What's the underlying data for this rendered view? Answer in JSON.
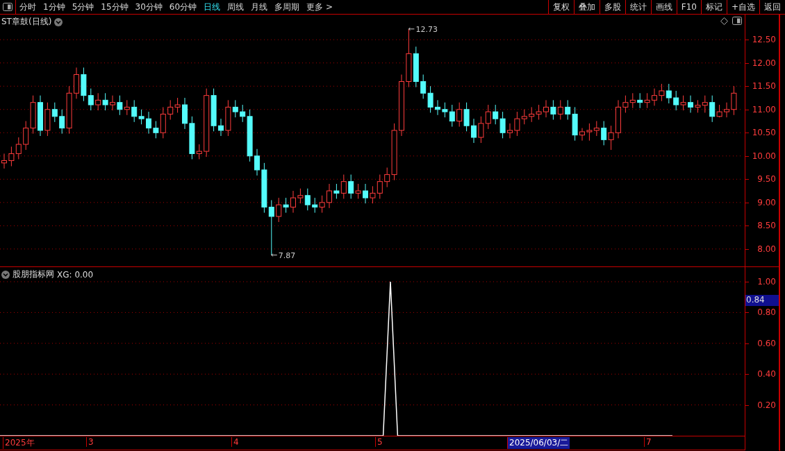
{
  "toolbar": {
    "periods": [
      {
        "label": "分时",
        "selected": false
      },
      {
        "label": "1分钟",
        "selected": false
      },
      {
        "label": "5分钟",
        "selected": false
      },
      {
        "label": "15分钟",
        "selected": false
      },
      {
        "label": "30分钟",
        "selected": false
      },
      {
        "label": "60分钟",
        "selected": false
      },
      {
        "label": "日线",
        "selected": true
      },
      {
        "label": "周线",
        "selected": false
      },
      {
        "label": "月线",
        "selected": false
      },
      {
        "label": "多周期",
        "selected": false
      },
      {
        "label": "更多 >",
        "selected": false
      }
    ],
    "buttons": [
      "复权",
      "叠加",
      "多股",
      "统计",
      "画线",
      "F10",
      "标记",
      "+自选",
      "返回"
    ]
  },
  "main_chart": {
    "title": "ST章鼓(日线)",
    "high_label": "12.73",
    "low_label": "7.87",
    "chart_data": {
      "type": "candlestick",
      "grid": true,
      "ylim": [
        7.61,
        13.04
      ],
      "yticks": [
        {
          "value": 12.5,
          "label": "12.50"
        },
        {
          "value": 12,
          "label": "12.00"
        },
        {
          "value": 11.5,
          "label": "11.50"
        },
        {
          "value": 11,
          "label": "11.00"
        },
        {
          "value": 10.5,
          "label": "10.50"
        },
        {
          "value": 10,
          "label": "10.00"
        },
        {
          "value": 9.5,
          "label": "9.50"
        },
        {
          "value": 9,
          "label": "9.00"
        },
        {
          "value": 8.5,
          "label": "8.50"
        },
        {
          "value": 8,
          "label": "8.00"
        }
      ],
      "ohlc": [
        [
          9.85,
          10.05,
          9.73,
          9.9
        ],
        [
          9.9,
          10.2,
          9.78,
          10.05
        ],
        [
          10.05,
          10.4,
          9.93,
          10.25
        ],
        [
          10.25,
          10.75,
          10.13,
          10.6
        ],
        [
          10.6,
          11.3,
          10.48,
          11.15
        ],
        [
          11.15,
          11.3,
          10.43,
          10.55
        ],
        [
          10.55,
          11.15,
          10.43,
          11.0
        ],
        [
          11.0,
          11.15,
          10.73,
          10.85
        ],
        [
          10.85,
          11.0,
          10.48,
          10.6
        ],
        [
          10.6,
          11.5,
          10.48,
          11.35
        ],
        [
          11.35,
          11.9,
          11.23,
          11.75
        ],
        [
          11.75,
          11.9,
          11.18,
          11.3
        ],
        [
          11.3,
          11.45,
          10.98,
          11.1
        ],
        [
          11.1,
          11.35,
          10.98,
          11.2
        ],
        [
          11.2,
          11.35,
          10.98,
          11.1
        ],
        [
          11.1,
          11.3,
          10.98,
          11.15
        ],
        [
          11.15,
          11.3,
          10.88,
          11.0
        ],
        [
          11.0,
          11.2,
          10.88,
          11.05
        ],
        [
          11.05,
          11.2,
          10.73,
          10.85
        ],
        [
          10.85,
          11.0,
          10.68,
          10.8
        ],
        [
          10.8,
          10.95,
          10.48,
          10.6
        ],
        [
          10.6,
          10.75,
          10.38,
          10.5
        ],
        [
          10.5,
          11.05,
          10.38,
          10.9
        ],
        [
          10.9,
          11.2,
          10.78,
          11.05
        ],
        [
          11.05,
          11.25,
          10.93,
          11.1
        ],
        [
          11.1,
          11.25,
          10.58,
          10.7
        ],
        [
          10.7,
          10.85,
          9.93,
          10.05
        ],
        [
          10.05,
          10.25,
          9.93,
          10.1
        ],
        [
          10.1,
          11.45,
          9.98,
          11.3
        ],
        [
          11.3,
          11.45,
          10.53,
          10.65
        ],
        [
          10.65,
          10.8,
          10.43,
          10.55
        ],
        [
          10.55,
          11.2,
          10.43,
          11.05
        ],
        [
          11.05,
          11.2,
          10.83,
          10.95
        ],
        [
          10.95,
          11.1,
          10.73,
          10.85
        ],
        [
          10.85,
          11.0,
          9.88,
          10.0
        ],
        [
          10.0,
          10.15,
          9.58,
          9.7
        ],
        [
          9.7,
          9.85,
          8.78,
          8.9
        ],
        [
          8.9,
          9.05,
          7.87,
          8.7
        ],
        [
          8.7,
          9.1,
          8.58,
          8.95
        ],
        [
          8.95,
          9.1,
          8.78,
          8.9
        ],
        [
          8.9,
          9.25,
          8.78,
          9.1
        ],
        [
          9.1,
          9.3,
          8.98,
          9.15
        ],
        [
          9.15,
          9.3,
          8.83,
          8.95
        ],
        [
          8.95,
          9.1,
          8.78,
          8.9
        ],
        [
          8.9,
          9.15,
          8.78,
          9.0
        ],
        [
          9.0,
          9.4,
          8.88,
          9.25
        ],
        [
          9.25,
          9.4,
          9.08,
          9.2
        ],
        [
          9.2,
          9.6,
          9.08,
          9.45
        ],
        [
          9.45,
          9.6,
          9.08,
          9.2
        ],
        [
          9.2,
          9.4,
          9.08,
          9.25
        ],
        [
          9.25,
          9.4,
          8.98,
          9.1
        ],
        [
          9.1,
          9.35,
          8.98,
          9.2
        ],
        [
          9.2,
          9.6,
          9.08,
          9.45
        ],
        [
          9.45,
          9.75,
          9.33,
          9.6
        ],
        [
          9.6,
          10.7,
          9.48,
          10.55
        ],
        [
          10.55,
          11.75,
          10.43,
          11.6
        ],
        [
          11.6,
          12.73,
          11.48,
          12.2
        ],
        [
          12.2,
          12.35,
          11.48,
          11.6
        ],
        [
          11.6,
          11.75,
          11.23,
          11.35
        ],
        [
          11.35,
          11.5,
          10.93,
          11.05
        ],
        [
          11.05,
          11.2,
          10.88,
          11.0
        ],
        [
          11.0,
          11.15,
          10.83,
          10.95
        ],
        [
          10.95,
          11.1,
          10.63,
          10.75
        ],
        [
          10.75,
          11.15,
          10.63,
          11.0
        ],
        [
          11.0,
          11.15,
          10.53,
          10.65
        ],
        [
          10.65,
          10.8,
          10.28,
          10.4
        ],
        [
          10.4,
          10.85,
          10.28,
          10.7
        ],
        [
          10.7,
          11.1,
          10.58,
          10.95
        ],
        [
          10.95,
          11.1,
          10.68,
          10.8
        ],
        [
          10.8,
          10.95,
          10.38,
          10.5
        ],
        [
          10.5,
          10.7,
          10.38,
          10.55
        ],
        [
          10.55,
          10.95,
          10.43,
          10.8
        ],
        [
          10.8,
          11.0,
          10.68,
          10.85
        ],
        [
          10.85,
          11.05,
          10.73,
          10.9
        ],
        [
          10.9,
          11.1,
          10.78,
          10.95
        ],
        [
          10.95,
          11.2,
          10.83,
          11.05
        ],
        [
          11.05,
          11.2,
          10.78,
          10.9
        ],
        [
          10.9,
          11.2,
          10.78,
          11.05
        ],
        [
          11.05,
          11.2,
          10.78,
          10.9
        ],
        [
          10.9,
          11.05,
          10.33,
          10.45
        ],
        [
          10.45,
          10.6,
          10.33,
          10.52
        ],
        [
          10.52,
          10.7,
          10.33,
          10.55
        ],
        [
          10.55,
          10.75,
          10.43,
          10.6
        ],
        [
          10.6,
          10.75,
          10.23,
          10.35
        ],
        [
          10.35,
          10.65,
          10.13,
          10.5
        ],
        [
          10.5,
          11.2,
          10.38,
          11.05
        ],
        [
          11.05,
          11.3,
          10.93,
          11.15
        ],
        [
          11.15,
          11.35,
          11.03,
          11.2
        ],
        [
          11.2,
          11.35,
          11.03,
          11.15
        ],
        [
          11.15,
          11.35,
          11.03,
          11.2
        ],
        [
          11.2,
          11.45,
          11.08,
          11.3
        ],
        [
          11.3,
          11.55,
          11.18,
          11.4
        ],
        [
          11.4,
          11.55,
          11.13,
          11.25
        ],
        [
          11.25,
          11.4,
          10.98,
          11.1
        ],
        [
          11.1,
          11.3,
          10.98,
          11.15
        ],
        [
          11.15,
          11.3,
          10.93,
          11.05
        ],
        [
          11.05,
          11.2,
          10.93,
          11.09
        ],
        [
          11.09,
          11.3,
          10.93,
          11.15
        ],
        [
          11.15,
          11.3,
          10.73,
          10.85
        ],
        [
          10.85,
          11.1,
          10.83,
          10.95
        ],
        [
          10.95,
          11.15,
          10.83,
          11.0
        ],
        [
          11.0,
          11.5,
          10.88,
          11.35
        ]
      ]
    }
  },
  "indicator": {
    "title": "股朋指标网",
    "readout": "XG: 0.00",
    "cursor_value": "0.84",
    "chart_data": {
      "type": "line",
      "grid": true,
      "ylim": [
        0,
        1
      ],
      "yticks": [
        {
          "value": 0.2,
          "label": "0.20"
        },
        {
          "value": 0.4,
          "label": "0.40"
        },
        {
          "value": 0.6,
          "label": "0.60"
        },
        {
          "value": 0.8,
          "label": "0.80"
        },
        {
          "value": 1,
          "label": "1.00"
        }
      ],
      "series": [
        {
          "color": "#ffffff",
          "values": [
            0,
            0,
            0,
            0,
            0,
            0,
            0,
            0,
            0,
            0,
            0,
            0,
            0,
            0,
            0,
            0,
            0,
            0,
            0,
            0,
            0,
            0,
            0,
            0,
            0,
            0,
            0,
            0,
            0,
            0,
            0,
            0,
            0,
            0,
            0,
            0,
            0,
            0,
            0,
            0,
            0,
            0,
            0,
            0,
            0,
            0,
            0,
            0,
            0,
            0,
            0,
            0,
            0,
            0,
            1,
            0,
            0,
            0,
            0,
            0,
            0,
            0,
            0,
            0,
            0,
            0,
            0,
            0,
            0,
            0,
            0,
            0,
            0,
            0,
            0,
            0,
            0,
            0,
            0,
            0,
            0,
            0,
            0,
            0,
            0,
            0,
            0,
            0,
            0,
            0,
            0,
            0,
            0,
            0,
            null,
            null,
            null,
            null,
            null,
            null,
            null,
            null,
            null,
            null
          ]
        }
      ]
    }
  },
  "date_axis": {
    "labels": [
      {
        "text": "2025年",
        "selected": false
      },
      {
        "text": "3",
        "selected": false
      },
      {
        "text": "4",
        "selected": false
      },
      {
        "text": "5",
        "selected": false
      },
      {
        "text": "2025/06/03/二",
        "selected": true
      },
      {
        "text": "7",
        "selected": false
      }
    ]
  }
}
